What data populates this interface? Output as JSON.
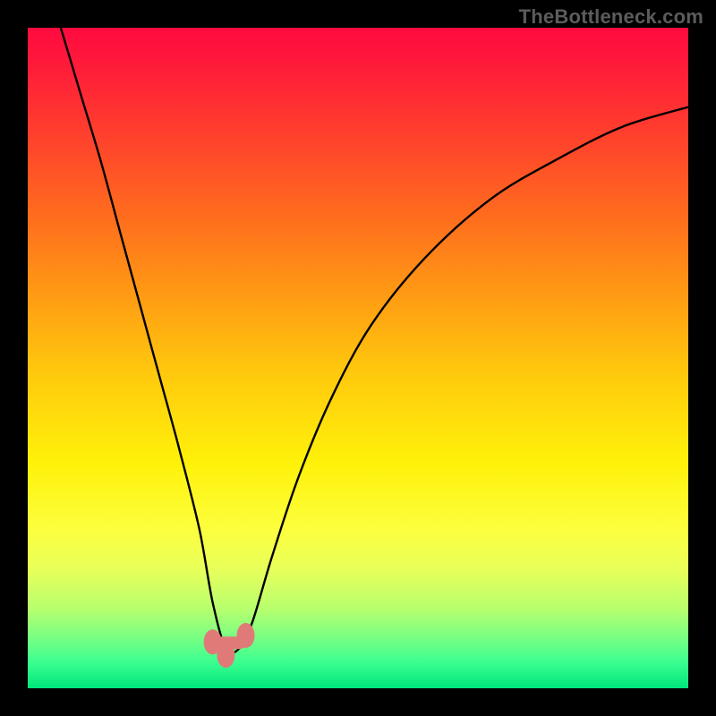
{
  "watermark": "TheBottleneck.com",
  "colors": {
    "frame": "#000000",
    "gradient_top": "#ff0a3f",
    "gradient_bottom": "#00e57c",
    "curve": "#000000",
    "marker": "#e07a78"
  },
  "chart_data": {
    "type": "line",
    "title": "",
    "xlabel": "",
    "ylabel": "",
    "xlim": [
      0,
      100
    ],
    "ylim": [
      0,
      100
    ],
    "note": "Axes unlabeled; values are estimated positions on a 0–100 normalized scale. The y value represents vertical distance from the bottom (0) to top (100). Curve resembles a bottleneck V shape with minimum near x≈30.",
    "series": [
      {
        "name": "curve",
        "x": [
          5,
          8,
          11,
          14,
          17,
          20,
          23,
          26,
          28,
          30,
          32,
          34,
          37,
          41,
          46,
          52,
          60,
          70,
          80,
          90,
          100
        ],
        "y": [
          100,
          90,
          80,
          69,
          58,
          47,
          36,
          24,
          13,
          6,
          6,
          10,
          20,
          32,
          44,
          55,
          65,
          74,
          80,
          85,
          88
        ]
      }
    ],
    "markers": [
      {
        "name": "trough-left",
        "x": 28,
        "y": 7
      },
      {
        "name": "trough-bottom",
        "x": 30,
        "y": 5
      },
      {
        "name": "trough-right",
        "x": 33,
        "y": 8
      }
    ]
  }
}
